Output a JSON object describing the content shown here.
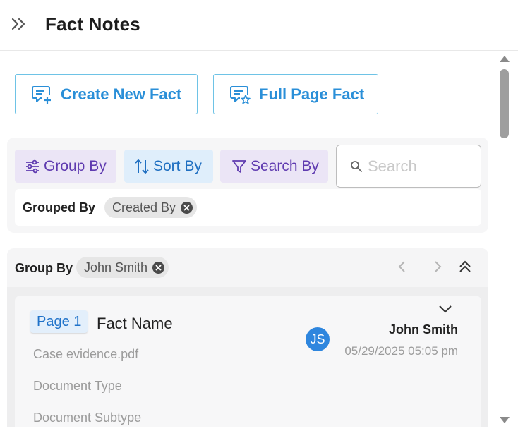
{
  "header": {
    "title": "Fact Notes",
    "expand_icon": "double-chevron-right-icon"
  },
  "actions": {
    "create_label": "Create New Fact",
    "full_page_label": "Full Page Fact"
  },
  "filters": {
    "group_by_label": "Group By",
    "sort_by_label": "Sort By",
    "search_by_label": "Search By",
    "search_placeholder": "Search",
    "grouped_by_label": "Grouped By",
    "grouped_by_value": "Created By"
  },
  "group": {
    "label": "Group By",
    "value": "John Smith"
  },
  "fact": {
    "page": "Page 1",
    "name": "Fact Name",
    "file": "Case evidence.pdf",
    "document_type": "Document Type",
    "document_subtype": "Document Subtype",
    "author_initials": "JS",
    "author": "John Smith",
    "timestamp": "05/29/2025 05:05 pm"
  },
  "colors": {
    "accent": "#2a8fd8",
    "purple": "#5f3bb0",
    "avatar": "#2e86de"
  }
}
